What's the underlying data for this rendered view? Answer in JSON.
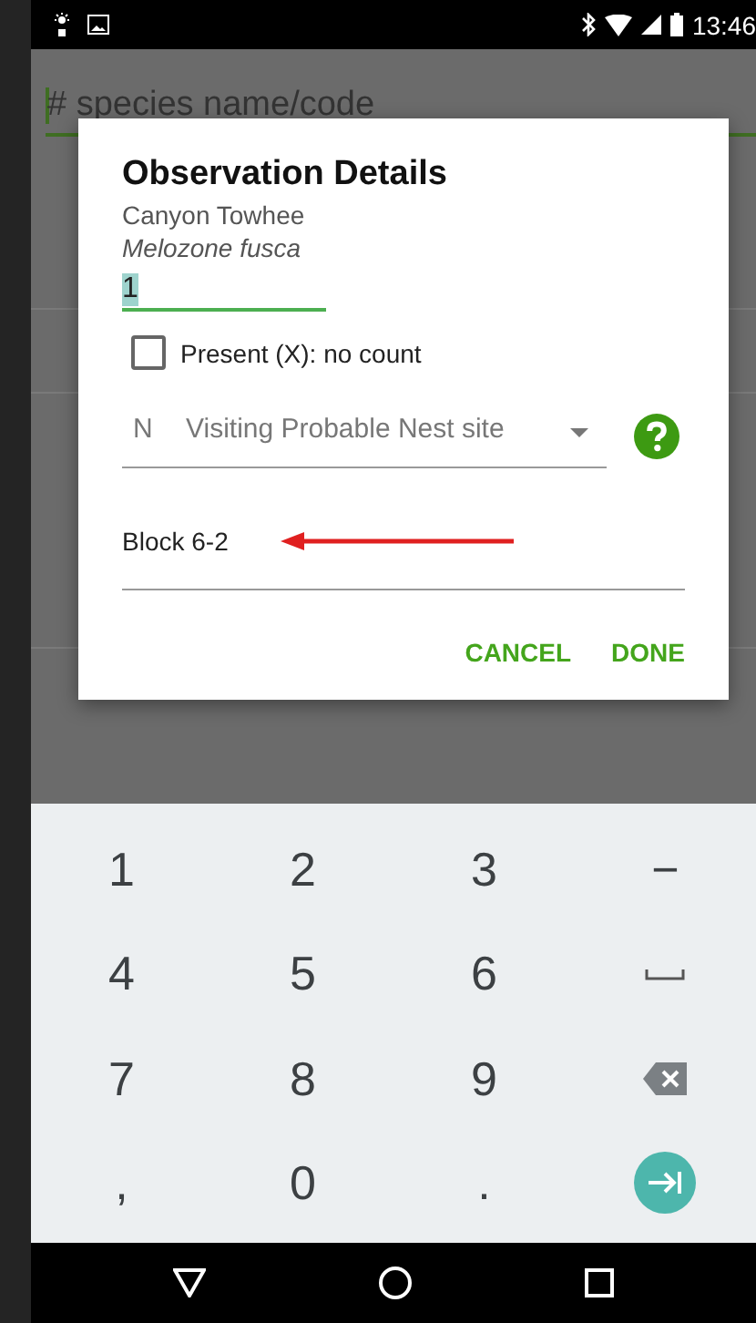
{
  "status_bar": {
    "time": "13:46"
  },
  "search": {
    "placeholder": "# species name/code"
  },
  "dialog": {
    "title": "Observation Details",
    "common_name": "Canyon Towhee",
    "scientific_name": "Melozone fusca",
    "count": {
      "value": "1",
      "text_selected": true
    },
    "present_checkbox": {
      "label": "Present (X): no count",
      "checked": false
    },
    "breeding_code": {
      "code": "N",
      "value": "Visiting Probable Nest site"
    },
    "location": {
      "value": "Block 6-2"
    },
    "buttons": [
      "CANCEL",
      "DONE"
    ]
  },
  "keyboard": {
    "keys": [
      {
        "kind": "text",
        "label": "1"
      },
      {
        "kind": "text",
        "label": "2"
      },
      {
        "kind": "text",
        "label": "3"
      },
      {
        "kind": "text",
        "label": "−"
      },
      {
        "kind": "text",
        "label": "4"
      },
      {
        "kind": "text",
        "label": "5"
      },
      {
        "kind": "text",
        "label": "6"
      },
      {
        "kind": "space"
      },
      {
        "kind": "text",
        "label": "7"
      },
      {
        "kind": "text",
        "label": "8"
      },
      {
        "kind": "text",
        "label": "9"
      },
      {
        "kind": "backspace"
      },
      {
        "kind": "text",
        "label": ","
      },
      {
        "kind": "text",
        "label": "0"
      },
      {
        "kind": "text",
        "label": "."
      },
      {
        "kind": "next"
      }
    ]
  }
}
